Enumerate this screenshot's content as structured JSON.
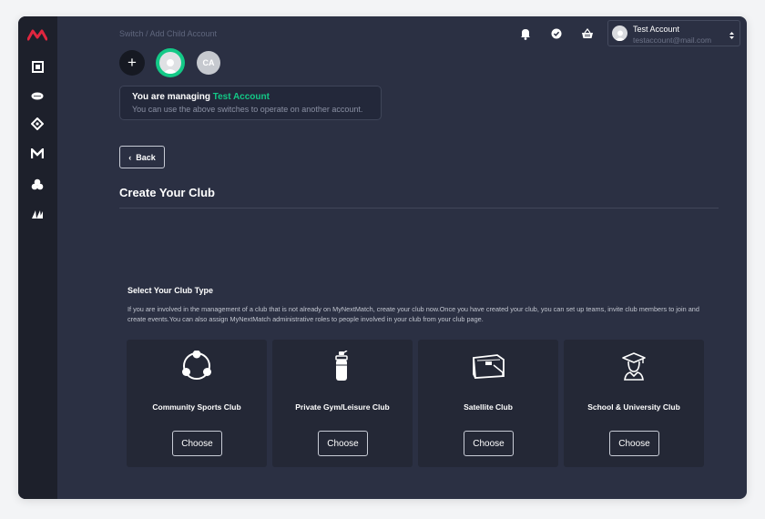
{
  "breadcrumb": "Switch / Add Child Account",
  "switcher": {
    "add_label": "+",
    "child_initials": "CA"
  },
  "managing": {
    "prefix": "You are managing",
    "account": "Test Account",
    "hint": "You can use the above switches to operate on another account."
  },
  "back_label": "Back",
  "page_title": "Create Your Club",
  "section": {
    "title": "Select Your Club Type",
    "description": "If you are involved in the management of a club that is not already on MyNextMatch, create your club now.Once you have created your club, you can set up teams, invite club members to join and create events.You can also assign MyNextMatch administrative roles to people involved in your club from your club page."
  },
  "club_types": [
    {
      "title": "Community Sports Club",
      "icon": "community-icon",
      "button": "Choose"
    },
    {
      "title": "Private Gym/Leisure Club",
      "icon": "water-bottle-icon",
      "button": "Choose"
    },
    {
      "title": "Satellite Club",
      "icon": "briefcase-icon",
      "button": "Choose"
    },
    {
      "title": "School & University Club",
      "icon": "graduate-icon",
      "button": "Choose"
    }
  ],
  "account": {
    "name": "Test Account",
    "email": "testaccount@mail.com"
  },
  "colors": {
    "brand": "#e0263f",
    "accent": "#13c987",
    "background": "#2b3043",
    "sidebar": "#1d202b"
  },
  "sidebar_icons": [
    "logo-icon",
    "dashboard-icon",
    "football-icon",
    "tag-icon",
    "mynextmatch-icon",
    "groups-icon",
    "arena-icon"
  ],
  "top_icons": [
    "bell-icon",
    "check-circle-icon",
    "basket-icon"
  ]
}
